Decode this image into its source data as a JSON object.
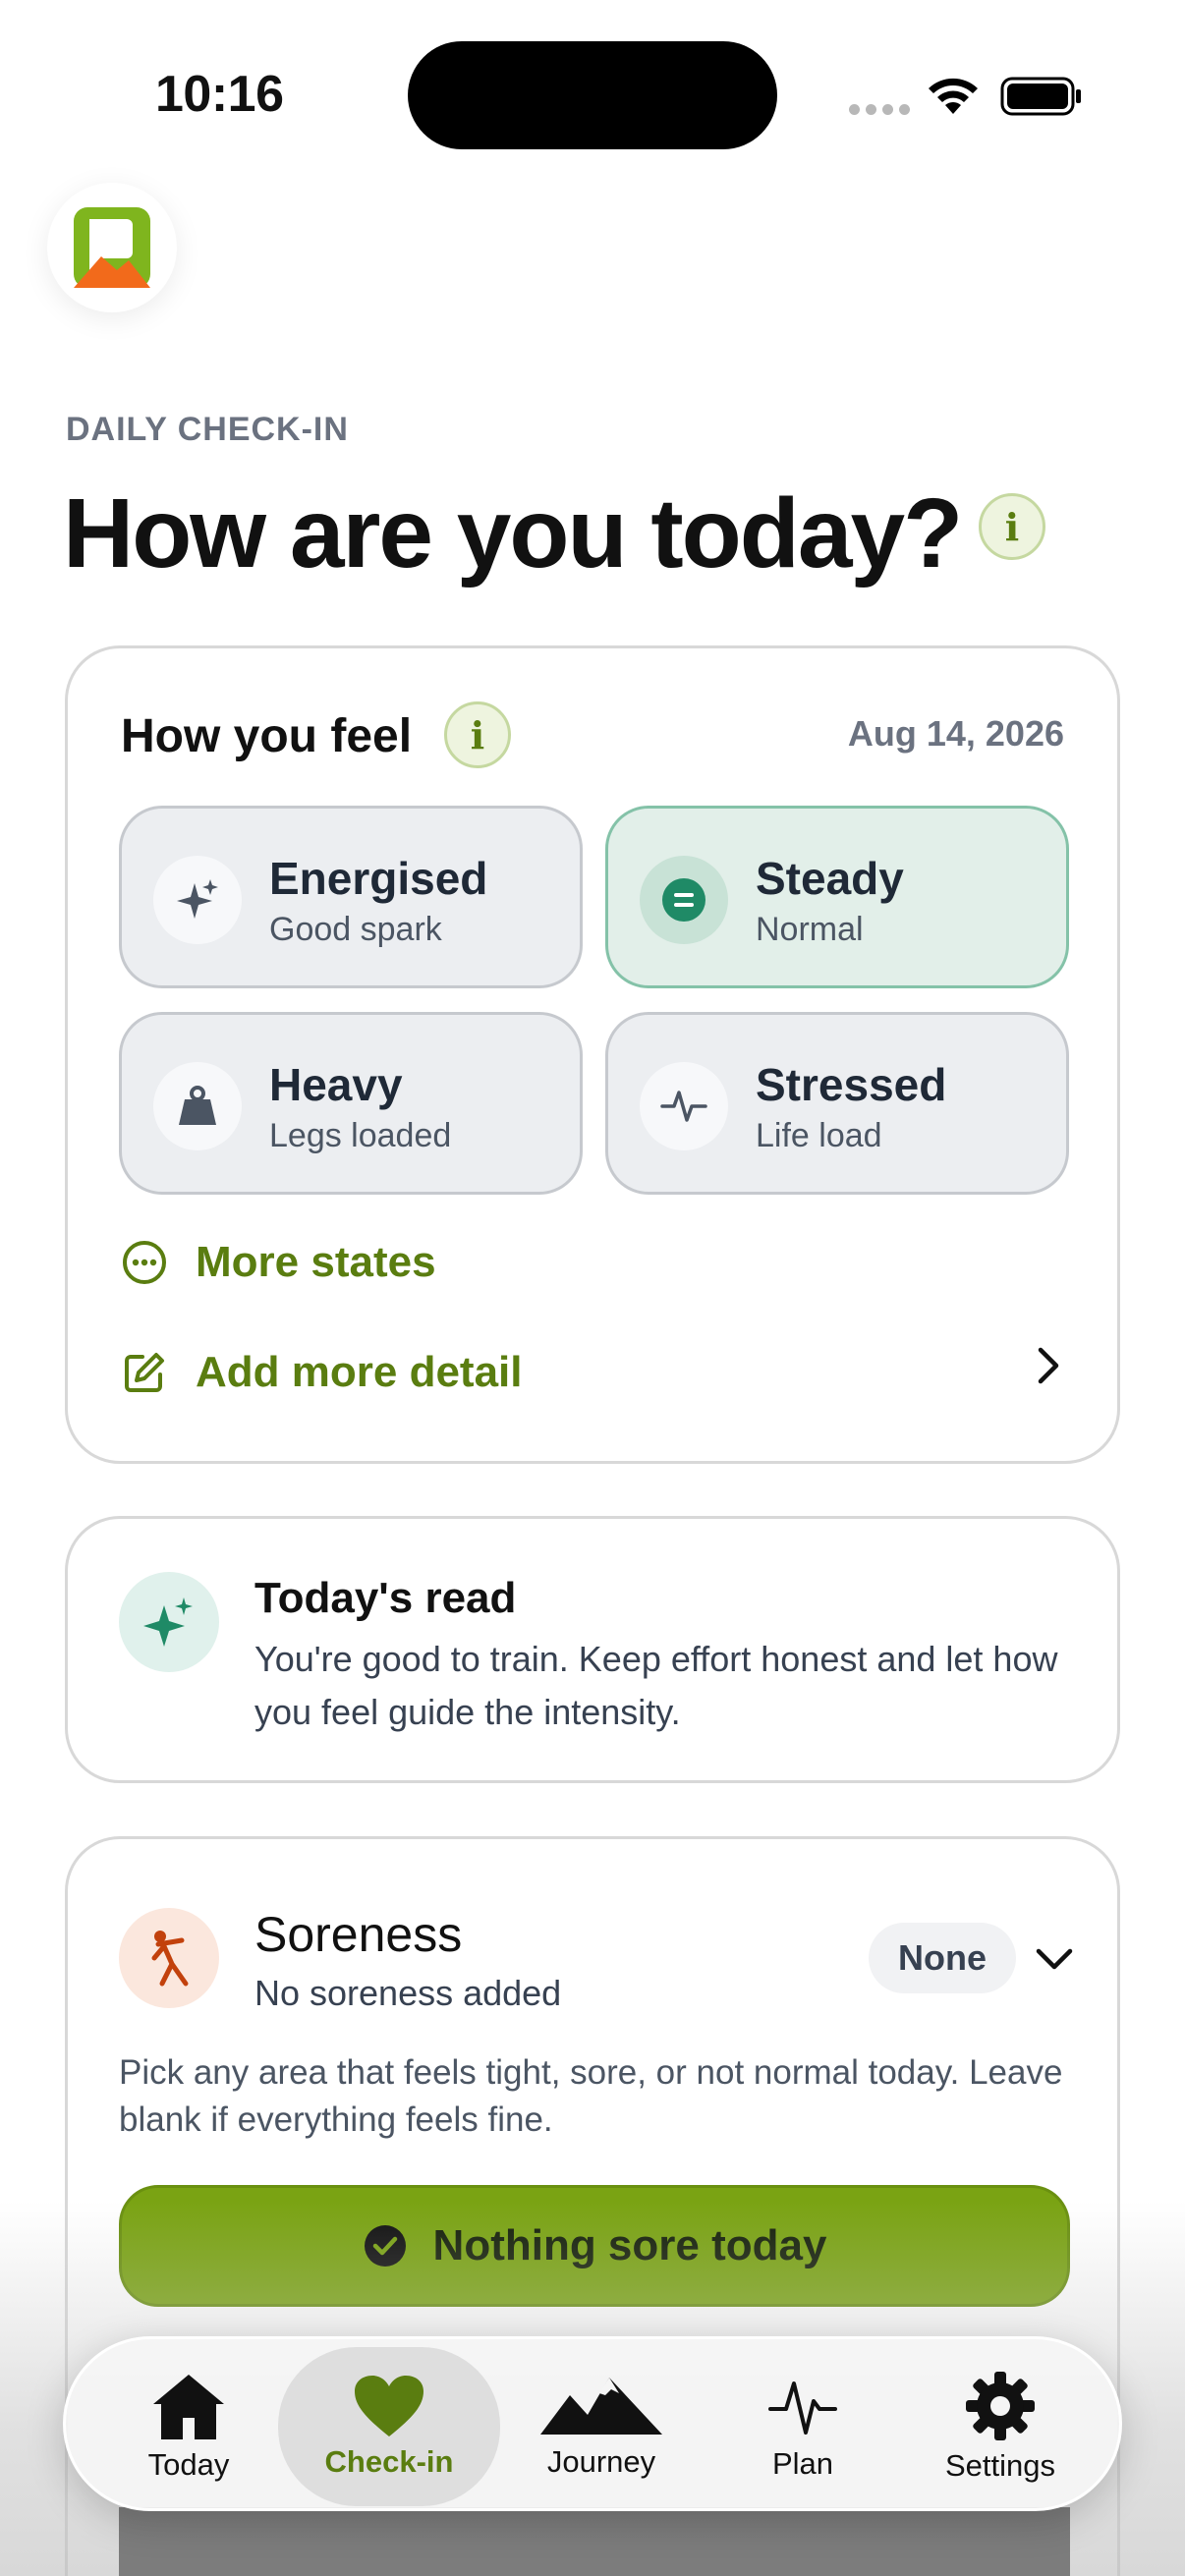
{
  "status_bar": {
    "time": "10:16"
  },
  "header": {
    "eyebrow": "DAILY CHECK-IN",
    "title": "How are you today?",
    "info_glyph": "i"
  },
  "feel_card": {
    "title": "How you feel",
    "info_glyph": "i",
    "date": "Aug 14, 2026",
    "moods": [
      {
        "label": "Energised",
        "sub": "Good spark",
        "icon": "sparkle-icon",
        "selected": false
      },
      {
        "label": "Steady",
        "sub": "Normal",
        "icon": "equals-icon",
        "selected": true
      },
      {
        "label": "Heavy",
        "sub": "Legs loaded",
        "icon": "weight-icon",
        "selected": false
      },
      {
        "label": "Stressed",
        "sub": "Life load",
        "icon": "pulse-icon",
        "selected": false
      }
    ],
    "more_states": "More states",
    "add_detail": "Add more detail"
  },
  "read_card": {
    "title": "Today's read",
    "body": "You're good to train. Keep effort honest and let how you feel guide the intensity."
  },
  "soreness_card": {
    "title": "Soreness",
    "subtitle": "No soreness added",
    "pill": "None",
    "help": "Pick any area that feels tight, sore, or not normal today. Leave blank if everything feels fine.",
    "nothing_button": "Nothing sore today"
  },
  "tab_bar": {
    "tabs": [
      {
        "label": "Today",
        "icon": "house-icon",
        "active": false
      },
      {
        "label": "Check-in",
        "icon": "heart-icon",
        "active": true
      },
      {
        "label": "Journey",
        "icon": "mountains-icon",
        "active": false
      },
      {
        "label": "Plan",
        "icon": "pulse-icon",
        "active": false
      },
      {
        "label": "Settings",
        "icon": "gear-icon",
        "active": false
      }
    ]
  },
  "colors": {
    "accent": "#5a7d10",
    "primary_button": "#7aa313",
    "selected_mood_bg": "#e2efe9",
    "selected_mood_border": "#84c2a8"
  }
}
